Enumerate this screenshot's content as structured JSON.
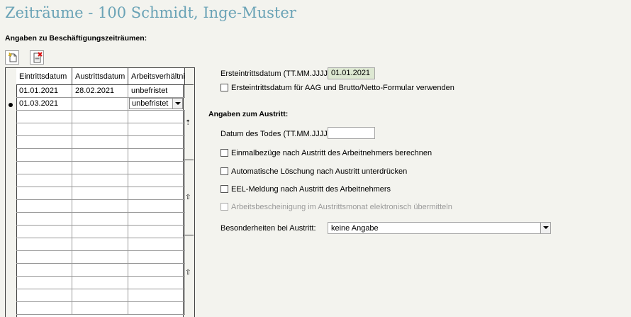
{
  "window": {
    "title": "Zeiträume - 100 Schmidt, Inge-Muster"
  },
  "employment": {
    "heading": "Angaben zu Beschäftigungszeiträumen:",
    "toolbar": {
      "new_icon": "new-record-icon",
      "delete_icon": "delete-record-icon"
    },
    "columns": [
      "Eintrittsdatum",
      "Austrittsdatum",
      "Arbeitsverhältnis"
    ],
    "rows": [
      {
        "eintritt": "01.01.2021",
        "austritt": "28.02.2021",
        "verhaeltnis": "unbefristet"
      },
      {
        "eintritt": "01.03.2021",
        "austritt": "",
        "verhaeltnis": "unbefristet"
      }
    ]
  },
  "entry": {
    "date_label": "Ersteintrittsdatum (TT.MM.JJJJ):",
    "date_value": "01.01.2021",
    "use_for_aag_label": "Ersteintrittsdatum für AAG und Brutto/Netto-Formular verwenden",
    "use_for_aag_checked": false
  },
  "exit": {
    "heading": "Angaben zum Austritt:",
    "death_date_label": "Datum des Todes (TT.MM.JJJJ):",
    "death_date_value": "",
    "options": [
      {
        "label": "Einmalbezüge nach Austritt des Arbeitnehmers berechnen",
        "checked": false,
        "disabled": false
      },
      {
        "label": "Automatische Löschung nach Austritt unterdrücken",
        "checked": false,
        "disabled": false
      },
      {
        "label": "EEL-Meldung nach Austritt des Arbeitnehmers",
        "checked": false,
        "disabled": false
      },
      {
        "label": "Arbeitsbescheinigung im Austrittsmonat elektronisch übermitteln",
        "checked": false,
        "disabled": true
      }
    ],
    "special_label": "Besonderheiten bei Austritt:",
    "special_value": "keine Angabe"
  }
}
